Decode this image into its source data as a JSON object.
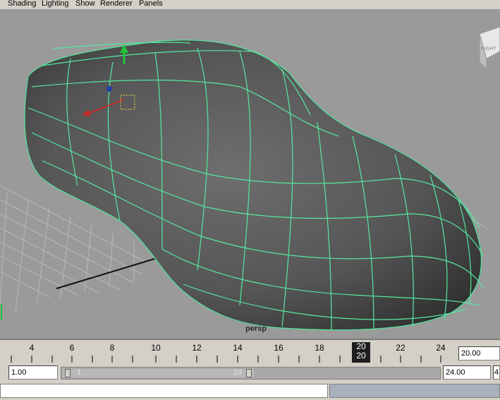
{
  "menu": {
    "items": [
      "Shading",
      "Lighting",
      "Show",
      "Renderer",
      "Panels"
    ]
  },
  "viewport": {
    "camera_label": "persp",
    "view_cube_label": "RIGHT"
  },
  "timeline": {
    "tick_labels": [
      "4",
      "6",
      "8",
      "10",
      "12",
      "14",
      "16",
      "18",
      "20",
      "22",
      "24"
    ],
    "current_frame": "20",
    "current_time_field": "20.00"
  },
  "range": {
    "start_field": "1.00",
    "slider_start_label": "1",
    "slider_end_label": "24",
    "end_field": "24.00",
    "overflow_field": "4"
  },
  "colors": {
    "wireframe": "#55e8a0",
    "viewport_bg": "#9a9a9a",
    "grid": "#b8b8b8"
  }
}
